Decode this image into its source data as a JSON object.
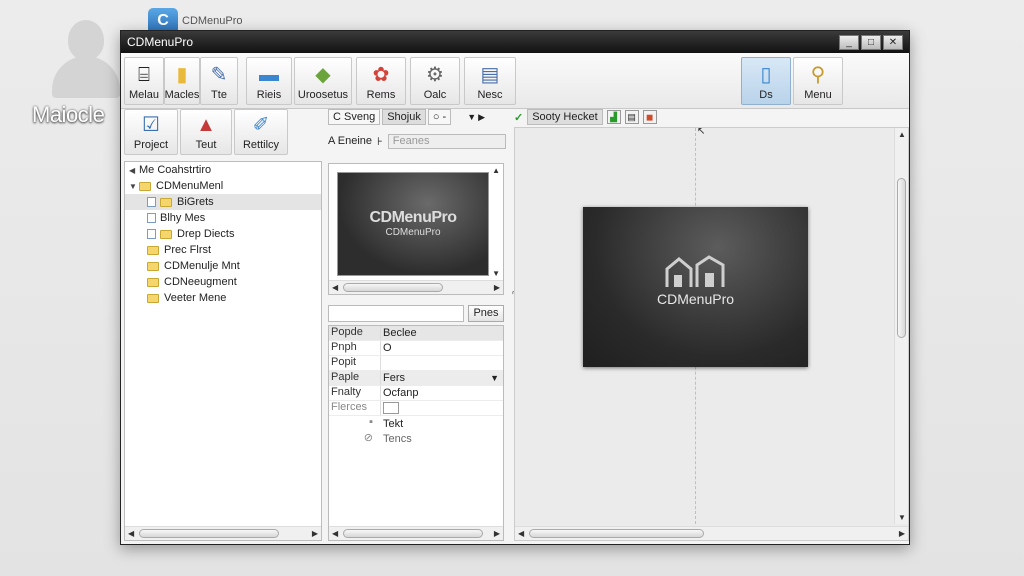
{
  "desktop": {
    "user_name": "Maiocle",
    "app_icon_glyph": "C",
    "app_icon_label": "CDMenuPro"
  },
  "window": {
    "title": "CDMenuPro",
    "controls": [
      "_",
      "□",
      "✕"
    ]
  },
  "ribbon": {
    "buttons": [
      {
        "label": "Melau",
        "icon": "menu-icon"
      },
      {
        "label": "Macles",
        "icon": "folder-icon"
      },
      {
        "label": "Tte",
        "icon": "wrench-icon"
      },
      {
        "label": "Rieis",
        "icon": "folder-blue-icon"
      },
      {
        "label": "Uroosetus",
        "icon": "tag-icon"
      },
      {
        "label": "Rems",
        "icon": "palette-icon"
      },
      {
        "label": "Oalc",
        "icon": "gear-icon"
      },
      {
        "label": "Nesc",
        "icon": "document-icon"
      },
      {
        "label": "Ds",
        "icon": "device-icon"
      },
      {
        "label": "Menu",
        "icon": "magnifier-icon"
      }
    ],
    "second_row": [
      {
        "label": "Project",
        "icon": "checklist-icon"
      },
      {
        "label": "Teut",
        "icon": "paint-icon"
      },
      {
        "label": "Rettilcy",
        "icon": "brush-icon"
      }
    ]
  },
  "tree": {
    "root": "Me Coahstrtiro",
    "items": [
      {
        "label": "CDMenuMenl",
        "expand": "▼"
      },
      {
        "label": "BiGrets"
      },
      {
        "label": "Blhy Mes"
      },
      {
        "label": "Drep Diects"
      },
      {
        "label": "Prec Flrst"
      },
      {
        "label": "CDMenulje Mnt"
      },
      {
        "label": "CDNeeugment"
      },
      {
        "label": "Veeter Mene"
      }
    ]
  },
  "middle": {
    "tabs": [
      "C Sveng",
      "Shojuk",
      "○ -"
    ],
    "filter_label": "A Eneine",
    "filter_placeholder": "Feanes",
    "preview_title": "CDMenuPro",
    "preview_sub": "CDMenuPro",
    "print_button": "Pnes",
    "props_header": [
      "Popde",
      "Beclee"
    ],
    "props": [
      {
        "k": "Pnph",
        "v": "O"
      },
      {
        "k": "Popit",
        "v": ""
      },
      {
        "k": "Paple",
        "v": "Fers"
      },
      {
        "k": "Fnalty",
        "v": "Ocfanp"
      },
      {
        "k": "Flerces",
        "v": ""
      },
      {
        "k": "",
        "v": "Tekt"
      },
      {
        "k": "",
        "v": "Tencs"
      }
    ]
  },
  "canvas": {
    "tab_label": "Sooty Hecket",
    "art_name": "CDMenuPro"
  }
}
